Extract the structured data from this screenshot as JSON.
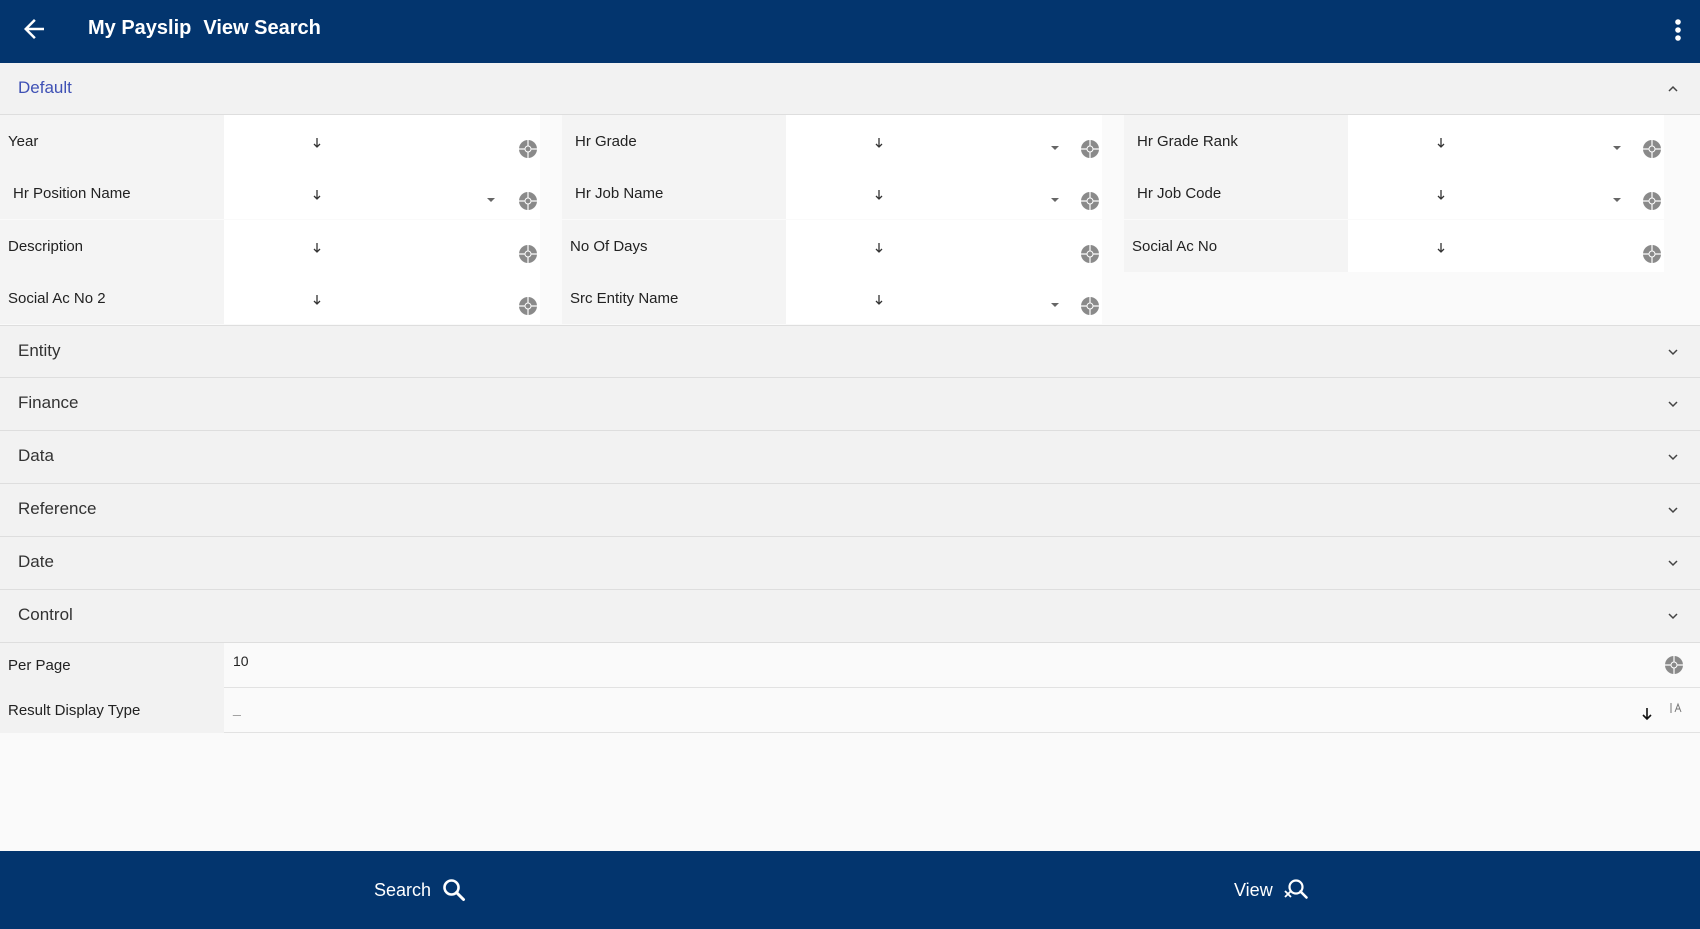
{
  "header": {
    "back_icon": "arrow-left-icon",
    "title_part1": "My Payslip",
    "title_part2": "View Search",
    "menu_icon": "more-vert-icon"
  },
  "sections": {
    "default": "Default",
    "entity": "Entity",
    "finance": "Finance",
    "data": "Data",
    "reference": "Reference",
    "date": "Date",
    "control": "Control"
  },
  "fields": {
    "year": "Year",
    "hr_grade": "Hr Grade",
    "hr_grade_rank": "Hr Grade Rank",
    "hr_position_name": "Hr Position Name",
    "hr_job_name": "Hr Job Name",
    "hr_job_code": "Hr Job Code",
    "description": "Description",
    "no_of_days": "No Of Days",
    "social_ac_no": "Social Ac No",
    "social_ac_no_2": "Social Ac No 2",
    "src_entity_name": "Src Entity Name"
  },
  "control": {
    "per_page_label": "Per Page",
    "per_page_value": "10",
    "result_display_type_label": "Result Display Type",
    "result_display_type_value": "_"
  },
  "footer": {
    "search_label": "Search",
    "view_label": "View"
  },
  "colors": {
    "primary": "#03356e",
    "section_active": "#3f51b5"
  }
}
